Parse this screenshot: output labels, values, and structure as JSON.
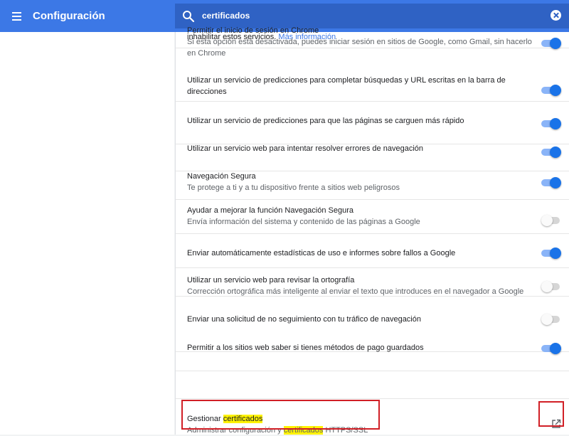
{
  "header": {
    "title": "Configuración",
    "menu_icon": "hamburger-menu-icon",
    "search_icon": "search-icon",
    "search_value": "certificados",
    "clear_icon": "clear-icon"
  },
  "colors": {
    "header_bg": "#3c78e6",
    "search_bg": "#2f62c4",
    "toggle_on": "#1a73e8",
    "link": "#3c78e6",
    "highlight": "#fff200",
    "annotation_red": "#d11f26"
  },
  "top_fragment": {
    "text": "inhabilitar estos servicios.",
    "link": "Más información"
  },
  "settings": [
    {
      "title": "Permitir el inicio de sesión en Chrome",
      "subtitle": "Si esta opción está desactivada, puedes iniciar sesión en sitios de Google, como Gmail, sin hacerlo en Chrome",
      "enabled": true
    },
    {
      "title": "Utilizar un servicio de predicciones para completar búsquedas y URL escritas en la barra de direcciones",
      "subtitle": "",
      "enabled": true
    },
    {
      "title": "Utilizar un servicio de predicciones para que las páginas se carguen más rápido",
      "subtitle": "",
      "enabled": true
    },
    {
      "title": "Utilizar un servicio web para intentar resolver errores de navegación",
      "subtitle": "",
      "enabled": true
    },
    {
      "title": "Navegación Segura",
      "subtitle": "Te protege a ti y a tu dispositivo frente a sitios web peligrosos",
      "enabled": true
    },
    {
      "title": "Ayudar a mejorar la función Navegación Segura",
      "subtitle": "Envía información del sistema y contenido de las páginas a Google",
      "enabled": false
    },
    {
      "title": "Enviar automáticamente estadísticas de uso e informes sobre fallos a Google",
      "subtitle": "",
      "enabled": true
    },
    {
      "title": "Utilizar un servicio web para revisar la ortografía",
      "subtitle": "Corrección ortográfica más inteligente al enviar el texto que introduces en el navegador a Google",
      "enabled": false
    },
    {
      "title": "Enviar una solicitud de no seguimiento con tu tráfico de navegación",
      "subtitle": "",
      "enabled": false
    },
    {
      "title": "Permitir a los sitios web saber si tienes métodos de pago guardados",
      "subtitle": "",
      "enabled": true
    }
  ],
  "certificates": {
    "title_prefix": "Gestionar",
    "title_highlight": "certificados",
    "subtitle_prefix": "Administrar configuración y",
    "subtitle_highlight": "certificados",
    "subtitle_suffix": "HTTPS/SSL",
    "icon": "open-in-new-icon"
  }
}
